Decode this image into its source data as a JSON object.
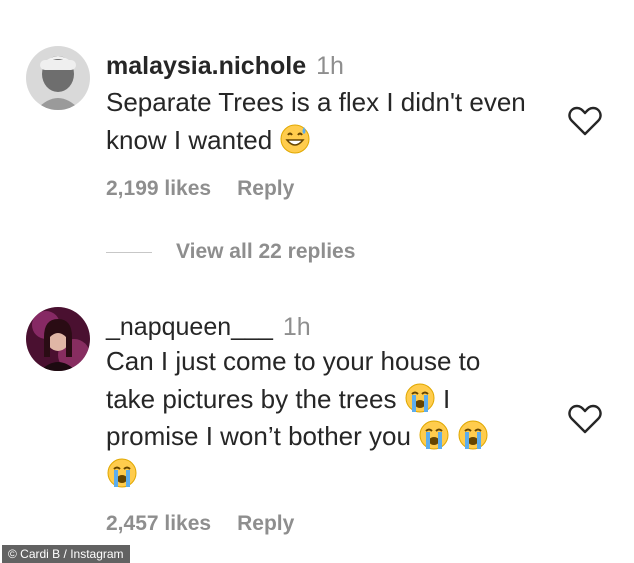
{
  "comments": [
    {
      "username": "malaysia.nichole",
      "time": "1h",
      "text_line1": "Separate Trees is a flex I didn't even",
      "text_line2": "know I wanted",
      "likes": "2,199 likes",
      "reply_label": "Reply",
      "emoji": "sweat-smile-emoji"
    },
    {
      "username": "_napqueen___",
      "time": "1h",
      "text_line1": "Can I just come to your house to",
      "text_line2": "take pictures by the trees",
      "text_line2_tail": "I",
      "text_line3": "promise I won’t bother you",
      "likes": "2,457 likes",
      "reply_label": "Reply",
      "emoji": "crying-emoji"
    }
  ],
  "view_replies_label": "View all 22 replies",
  "credit": "© Cardi B / Instagram",
  "icons": {
    "like": "heart-outline-icon"
  },
  "colors": {
    "text": "#262626",
    "secondary": "#8e8e8e",
    "emoji_yellow": "#ffcc4d"
  }
}
